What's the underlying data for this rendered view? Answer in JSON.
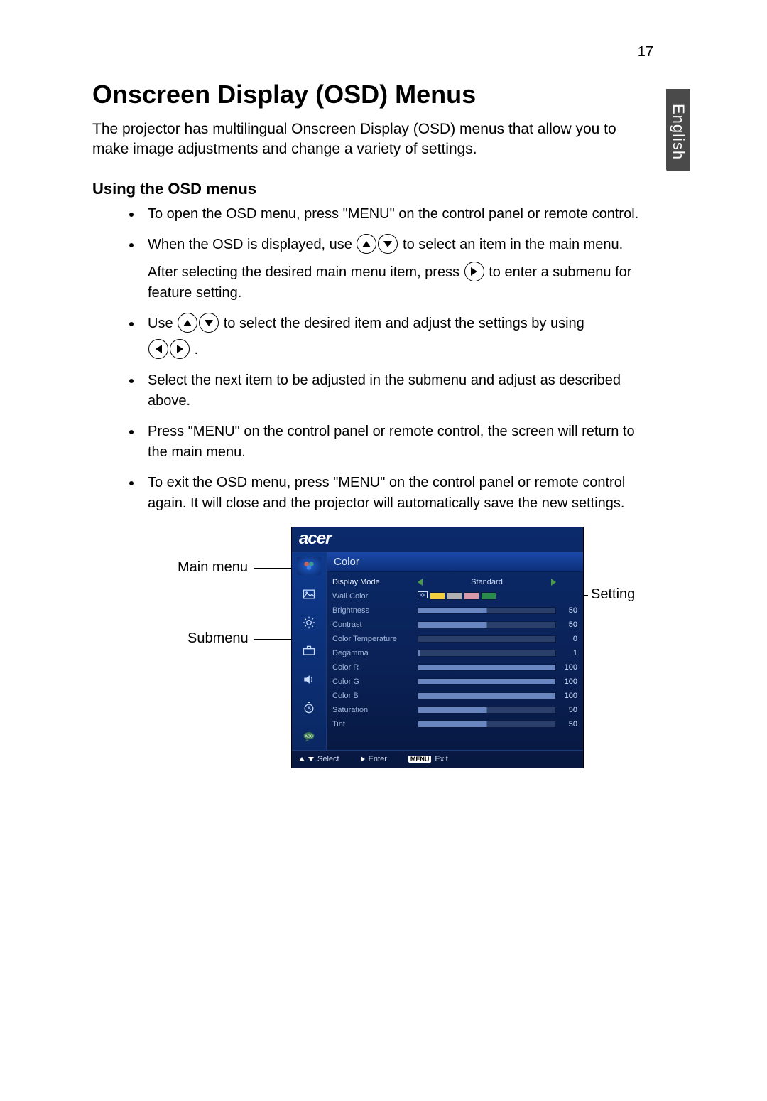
{
  "page_number": "17",
  "lang_tab": "English",
  "title": "Onscreen Display (OSD) Menus",
  "intro": "The projector has multilingual Onscreen Display (OSD) menus that allow you to make image adjustments and change a variety of settings.",
  "subheading": "Using the OSD menus",
  "bullets": {
    "b1": "To open the OSD menu, press \"MENU\" on the control panel or remote control.",
    "b2a": "When the OSD is displayed, use ",
    "b2b": " to select an item in the main menu.",
    "b2c": "After selecting the desired main menu item, press ",
    "b2d": " to enter a submenu for feature setting.",
    "b3a": "Use ",
    "b3b": " to select the desired item and adjust the settings by using ",
    "b3c": ".",
    "b4": "Select the next item to be adjusted in the submenu and adjust as described above.",
    "b5": "Press \"MENU\" on the control panel or remote control, the screen will return to the main menu.",
    "b6": "To exit the OSD menu, press \"MENU\" on the control panel or remote control again. It will close and the projector will automatically save the new settings."
  },
  "callouts": {
    "main_menu": "Main menu",
    "submenu": "Submenu",
    "setting": "Setting"
  },
  "osd": {
    "logo": "acer",
    "category": "Color",
    "rows": [
      {
        "label": "Display Mode",
        "type": "mode",
        "value": "Standard"
      },
      {
        "label": "Wall Color",
        "type": "swatch",
        "colors": [
          "#f0d040",
          "#b0b0b0",
          "#d89aa8",
          "#2a8a4a"
        ]
      },
      {
        "label": "Brightness",
        "type": "slider",
        "value": 50,
        "max": 100
      },
      {
        "label": "Contrast",
        "type": "slider",
        "value": 50,
        "max": 100
      },
      {
        "label": "Color Temperature",
        "type": "slider",
        "value": 0,
        "max": 100
      },
      {
        "label": "Degamma",
        "type": "slider",
        "value": 1,
        "max": 100
      },
      {
        "label": "Color R",
        "type": "slider",
        "value": 100,
        "max": 100
      },
      {
        "label": "Color G",
        "type": "slider",
        "value": 100,
        "max": 100
      },
      {
        "label": "Color B",
        "type": "slider",
        "value": 100,
        "max": 100
      },
      {
        "label": "Saturation",
        "type": "slider",
        "value": 50,
        "max": 100
      },
      {
        "label": "Tint",
        "type": "slider",
        "value": 50,
        "max": 100
      }
    ],
    "footer": {
      "select": "Select",
      "enter": "Enter",
      "menu_btn": "MENU",
      "exit": "Exit"
    }
  }
}
